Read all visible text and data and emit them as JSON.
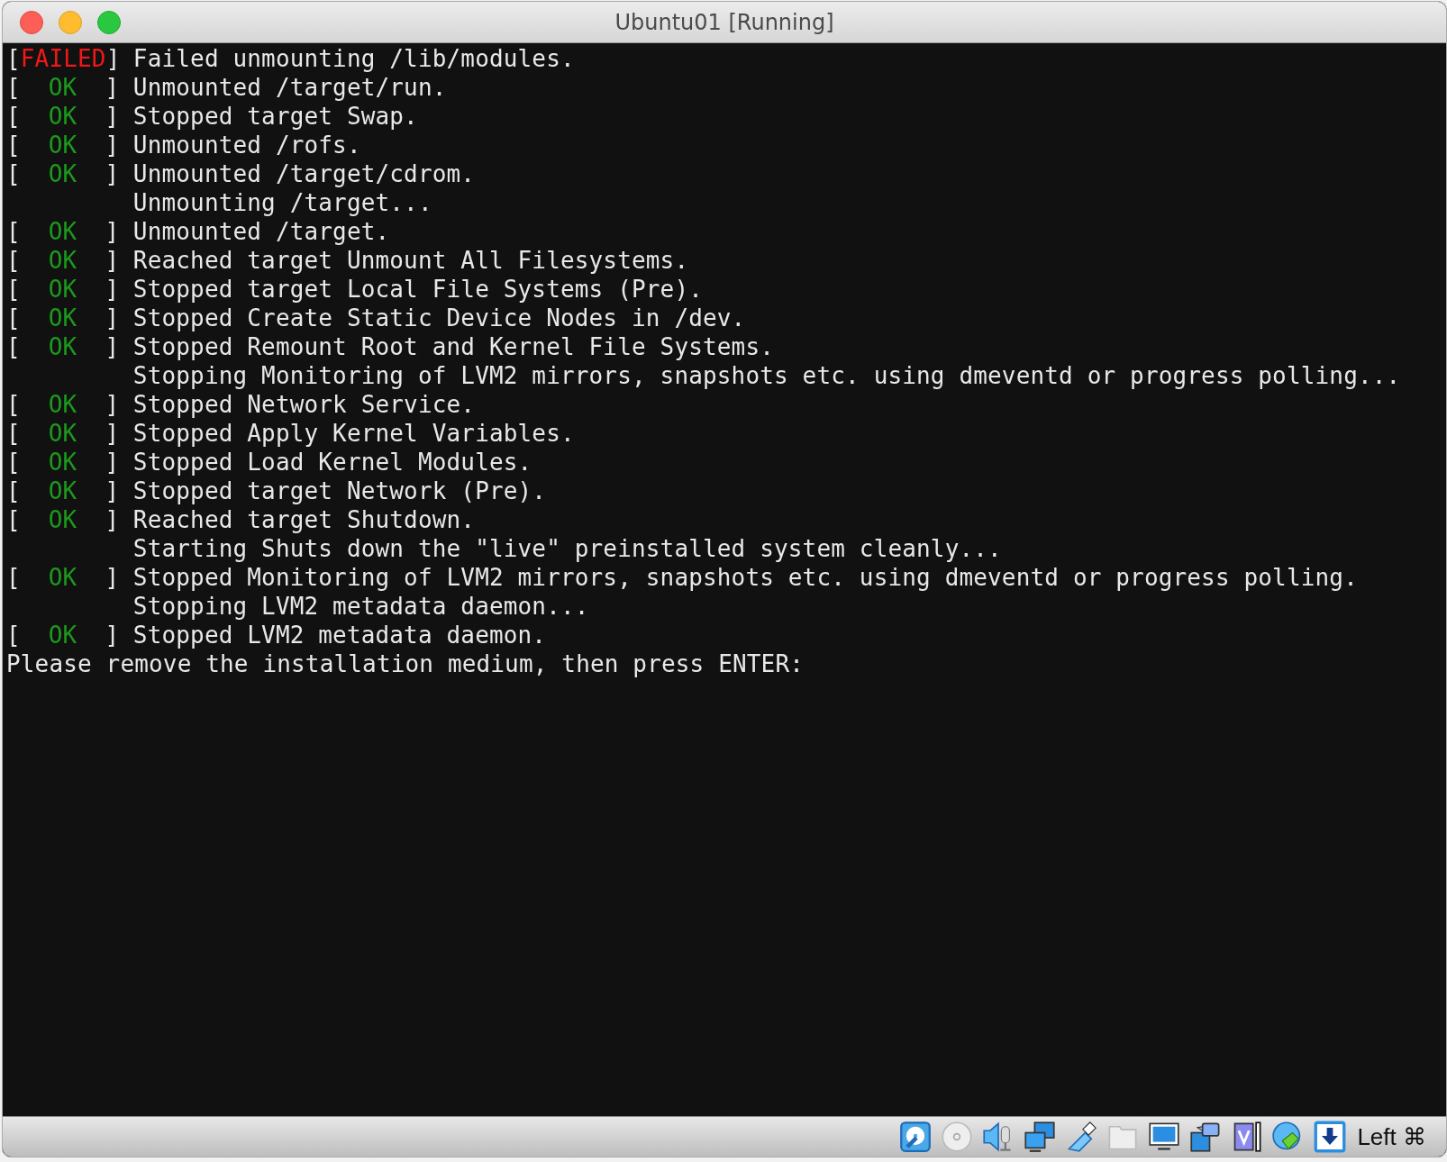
{
  "window": {
    "title": "Ubuntu01 [Running]"
  },
  "console": {
    "lines": [
      {
        "tag": {
          "open": "[",
          "label": "FAILED",
          "close": "]",
          "kind": "failed"
        },
        "text": "Failed unmounting /lib/modules."
      },
      {
        "tag": {
          "open": "[",
          "label": "OK",
          "close": "]",
          "kind": "ok"
        },
        "text": "Unmounted /target/run."
      },
      {
        "tag": {
          "open": "[",
          "label": "OK",
          "close": "]",
          "kind": "ok"
        },
        "text": "Stopped target Swap."
      },
      {
        "tag": {
          "open": "[",
          "label": "OK",
          "close": "]",
          "kind": "ok"
        },
        "text": "Unmounted /rofs."
      },
      {
        "tag": {
          "open": "[",
          "label": "OK",
          "close": "]",
          "kind": "ok"
        },
        "text": "Unmounted /target/cdrom."
      },
      {
        "text": "Unmounting /target..."
      },
      {
        "tag": {
          "open": "[",
          "label": "OK",
          "close": "]",
          "kind": "ok"
        },
        "text": "Unmounted /target."
      },
      {
        "tag": {
          "open": "[",
          "label": "OK",
          "close": "]",
          "kind": "ok"
        },
        "text": "Reached target Unmount All Filesystems."
      },
      {
        "tag": {
          "open": "[",
          "label": "OK",
          "close": "]",
          "kind": "ok"
        },
        "text": "Stopped target Local File Systems (Pre)."
      },
      {
        "tag": {
          "open": "[",
          "label": "OK",
          "close": "]",
          "kind": "ok"
        },
        "text": "Stopped Create Static Device Nodes in /dev."
      },
      {
        "tag": {
          "open": "[",
          "label": "OK",
          "close": "]",
          "kind": "ok"
        },
        "text": "Stopped Remount Root and Kernel File Systems."
      },
      {
        "text": "Stopping Monitoring of LVM2 mirrors, snapshots etc. using dmeventd or progress polling..."
      },
      {
        "tag": {
          "open": "[",
          "label": "OK",
          "close": "]",
          "kind": "ok"
        },
        "text": "Stopped Network Service."
      },
      {
        "tag": {
          "open": "[",
          "label": "OK",
          "close": "]",
          "kind": "ok"
        },
        "text": "Stopped Apply Kernel Variables."
      },
      {
        "tag": {
          "open": "[",
          "label": "OK",
          "close": "]",
          "kind": "ok"
        },
        "text": "Stopped Load Kernel Modules."
      },
      {
        "tag": {
          "open": "[",
          "label": "OK",
          "close": "]",
          "kind": "ok"
        },
        "text": "Stopped target Network (Pre)."
      },
      {
        "tag": {
          "open": "[",
          "label": "OK",
          "close": "]",
          "kind": "ok"
        },
        "text": "Reached target Shutdown."
      },
      {
        "text": "Starting Shuts down the \"live\" preinstalled system cleanly..."
      },
      {
        "tag": {
          "open": "[",
          "label": "OK",
          "close": "]",
          "kind": "ok"
        },
        "text": "Stopped Monitoring of LVM2 mirrors, snapshots etc. using dmeventd or progress polling."
      },
      {
        "text": "Stopping LVM2 metadata daemon..."
      },
      {
        "tag": {
          "open": "[",
          "label": "OK",
          "close": "]",
          "kind": "ok"
        },
        "text": "Stopped LVM2 metadata daemon."
      }
    ],
    "prompt": "Please remove the installation medium, then press ENTER:"
  },
  "status_bar": {
    "host_key": "Left ⌘"
  }
}
